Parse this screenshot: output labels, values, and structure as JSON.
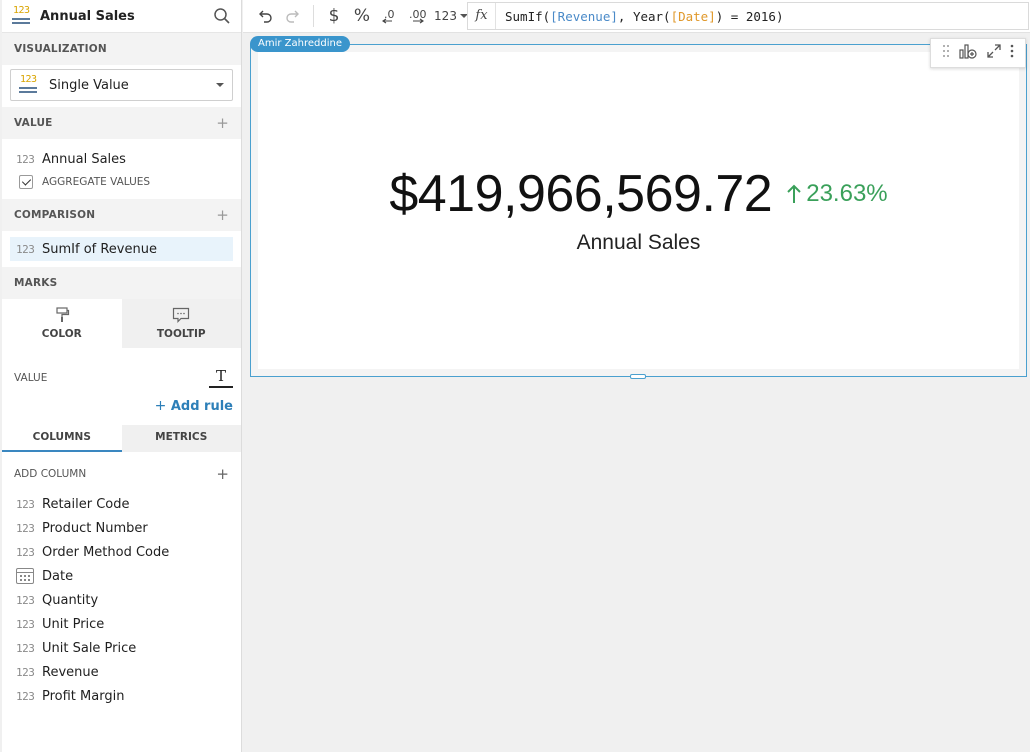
{
  "sidebar": {
    "header_title": "Annual Sales",
    "sections": {
      "visualization": "VISUALIZATION",
      "value": "VALUE",
      "comparison": "COMPARISON",
      "marks": "MARKS"
    },
    "visualization_type": "Single Value",
    "value_field": {
      "icon": "123",
      "label": "Annual Sales"
    },
    "aggregate_label": "AGGREGATE VALUES",
    "comparison_field": {
      "icon": "123",
      "label": "SumIf of Revenue"
    },
    "marks_tabs": [
      "COLOR",
      "TOOLTIP"
    ],
    "value_label": "VALUE",
    "add_rule": "Add rule",
    "column_tabs": [
      "COLUMNS",
      "METRICS"
    ],
    "add_column": "ADD COLUMN",
    "columns": [
      {
        "icon": "123",
        "label": "Retailer Code"
      },
      {
        "icon": "123",
        "label": "Product Number"
      },
      {
        "icon": "123",
        "label": "Order Method Code"
      },
      {
        "icon": "calendar",
        "label": "Date"
      },
      {
        "icon": "123",
        "label": "Quantity"
      },
      {
        "icon": "123",
        "label": "Unit Price"
      },
      {
        "icon": "123",
        "label": "Unit Sale Price"
      },
      {
        "icon": "123",
        "label": "Revenue"
      },
      {
        "icon": "123",
        "label": "Profit Margin"
      }
    ]
  },
  "toolbar": {
    "number_format": "123",
    "formula": {
      "fn": "SumIf(",
      "ref1": "[Revenue]",
      "mid": ", Year(",
      "ref2": "[Date]",
      "end": ") = 2016)"
    }
  },
  "card": {
    "author": "Amir Zahreddine",
    "value": "$419,966,569.72",
    "change": "23.63%",
    "change_direction": "up",
    "label": "Annual Sales"
  },
  "colors": {
    "accent": "#3a95cc",
    "positive": "#3aa05a",
    "formula_ref_blue": "#4a8ac8",
    "formula_ref_orange": "#e0982a"
  }
}
